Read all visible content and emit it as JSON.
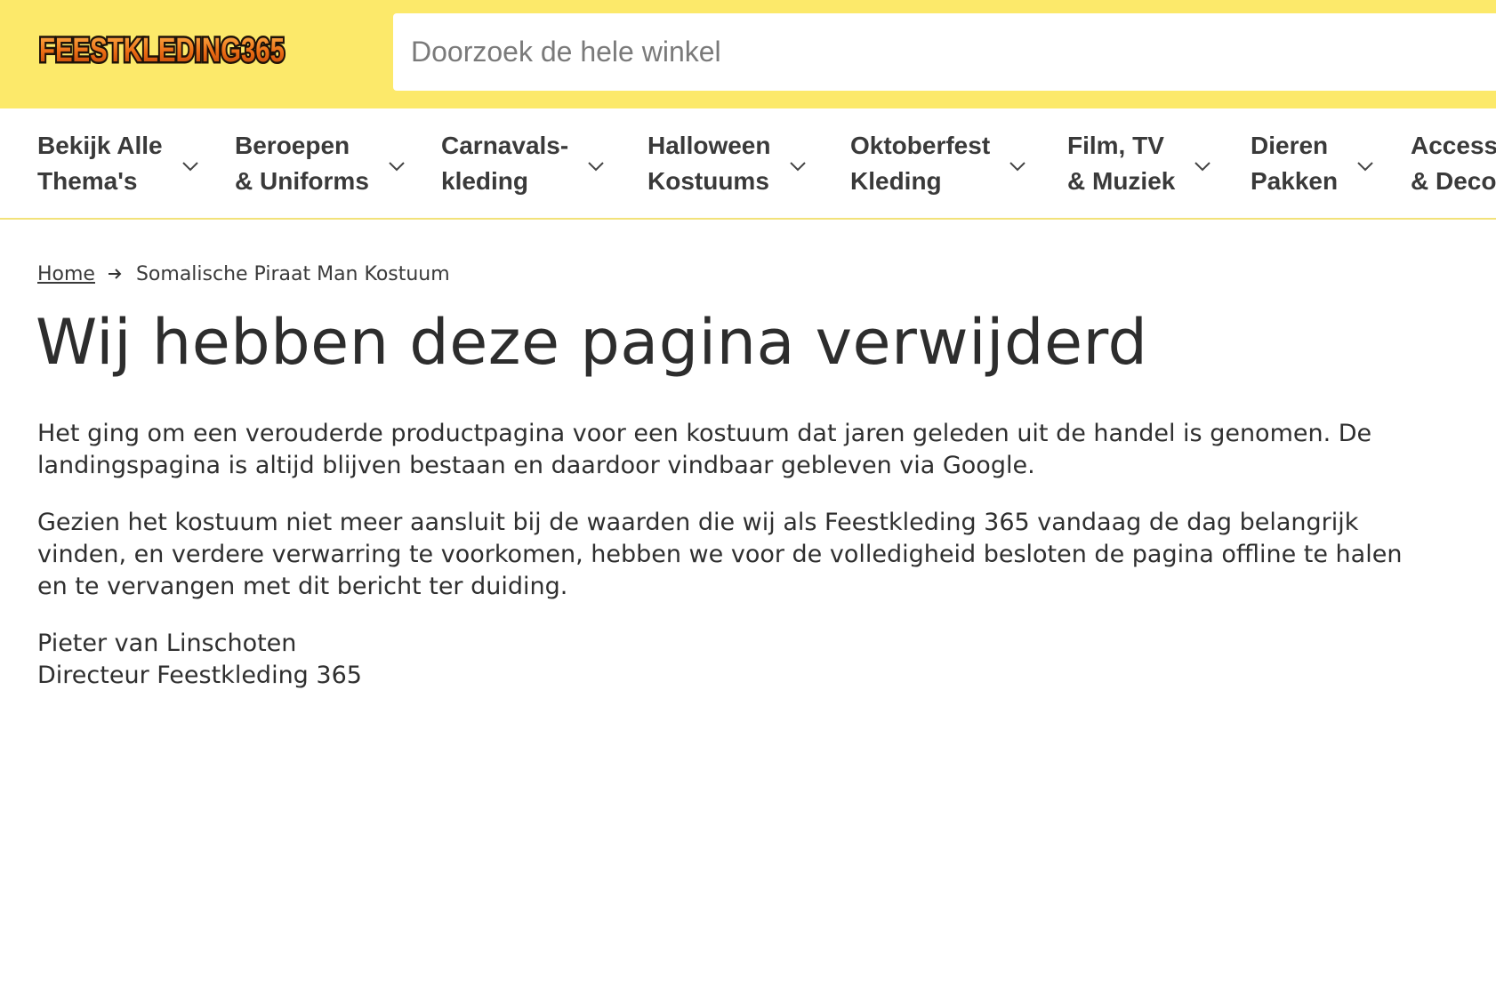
{
  "header": {
    "logo_text": "FEESTKLEDING365",
    "search_placeholder": "Doorzoek de hele winkel"
  },
  "nav": {
    "items": [
      {
        "line1": "Bekijk Alle",
        "line2": "Thema's"
      },
      {
        "line1": "Beroepen",
        "line2": "& Uniforms"
      },
      {
        "line1": "Carnavals-",
        "line2": "kleding"
      },
      {
        "line1": "Halloween",
        "line2": "Kostuums"
      },
      {
        "line1": "Oktoberfest",
        "line2": "Kleding"
      },
      {
        "line1": "Film, TV",
        "line2": "& Muziek"
      },
      {
        "line1": "Dieren",
        "line2": "Pakken"
      },
      {
        "line1": "Access",
        "line2": "& Deco"
      }
    ]
  },
  "breadcrumb": {
    "home": "Home",
    "current": "Somalische Piraat Man Kostuum"
  },
  "page": {
    "title": "Wij hebben deze pagina verwijderd",
    "paragraph1": "Het ging om een verouderde productpagina voor een kostuum dat jaren geleden uit de handel is genomen. De landingspagina is altijd blijven bestaan en daardoor vindbaar gebleven via Google.",
    "paragraph2": "Gezien het kostuum niet meer aansluit bij de waarden die wij als Feestkleding 365 vandaag de dag belangrijk vinden, en verdere verwarring te voorkomen, hebben we voor de volledigheid besloten de pagina offline te halen en te vervangen met dit bericht ter duiding.",
    "signature_name": "Pieter van Linschoten",
    "signature_title": "Directeur Feestkleding 365"
  },
  "colors": {
    "header_bg": "#fce96a",
    "text": "#2b2b2b",
    "logo_orange": "#e8701e"
  }
}
